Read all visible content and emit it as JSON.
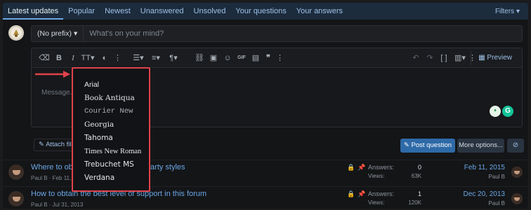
{
  "tabs": [
    "Latest updates",
    "Popular",
    "Newest",
    "Unanswered",
    "Unsolved",
    "Your questions",
    "Your answers"
  ],
  "filters_label": "Filters",
  "composer": {
    "prefix_value": "(No prefix)",
    "title_placeholder": "What's on your mind?",
    "body_placeholder": "Message...",
    "preview_label": "Preview",
    "gif_label": "GIF",
    "attach_label": "Attach files",
    "post_label": "Post question",
    "more_label": "More options..."
  },
  "font_menu": [
    "Arial",
    "Book Antiqua",
    "Courier New",
    "Georgia",
    "Tahoma",
    "Times New Roman",
    "Trebuchet MS",
    "Verdana"
  ],
  "threads": [
    {
      "title_left": "Where to ob",
      "title_right": "party styles",
      "author_meta": "Paul B · Feb 11, 2",
      "answers_label": "Answers:",
      "answers": "0",
      "views_label": "Views:",
      "views": "63K",
      "last_date": "Feb 11, 2015",
      "last_user": "Paul B"
    },
    {
      "title": "How to obtain the best level of support in this forum",
      "author_meta": "Paul B · Jul 31, 2013",
      "answers_label": "Answers:",
      "answers": "1",
      "views_label": "Views:",
      "views": "120K",
      "last_date": "Dec 20, 2013",
      "last_user": "Paul B"
    }
  ],
  "colors": {
    "accent": "#6aa7e6",
    "highlight_border": "#e0434a",
    "primary_button": "#2e6aa8"
  }
}
